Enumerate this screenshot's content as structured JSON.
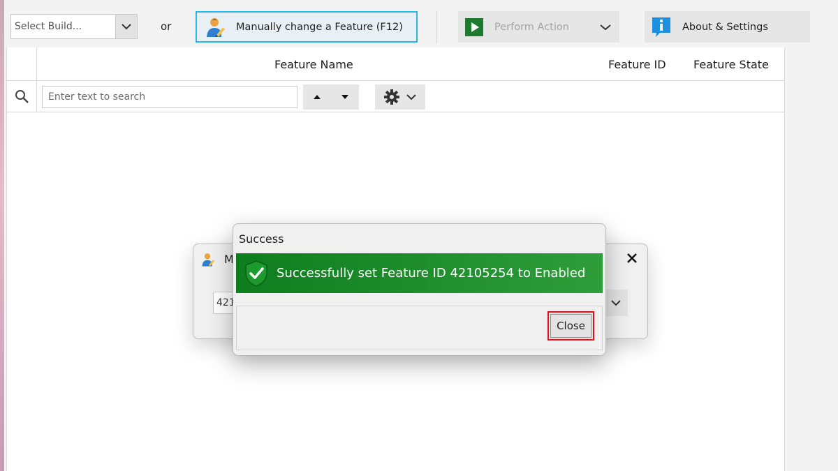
{
  "toolbar": {
    "build_placeholder": "Select Build...",
    "or_label": "or",
    "manual_change_label": "Manually change a Feature (F12)",
    "perform_action_label": "Perform Action",
    "about_settings_label": "About & Settings"
  },
  "grid": {
    "columns": [
      "Feature Name",
      "Feature ID",
      "Feature State"
    ],
    "search_placeholder": "Enter text to search"
  },
  "background_dialog": {
    "title_fragment": "M",
    "field_value_fragment": "421"
  },
  "success_dialog": {
    "title": "Success",
    "message": "Successfully set Feature ID 42105254 to Enabled",
    "close_label": "Close"
  },
  "colors": {
    "success_green": "#1a8a2a",
    "focus_border": "#29b6e8",
    "highlight_red": "#e0101a"
  },
  "icons": {
    "manual_change": "user-edit-icon",
    "perform_action": "play-icon",
    "about": "info-icon",
    "search": "search-icon",
    "settings": "gear-icon",
    "success": "shield-check-icon"
  }
}
